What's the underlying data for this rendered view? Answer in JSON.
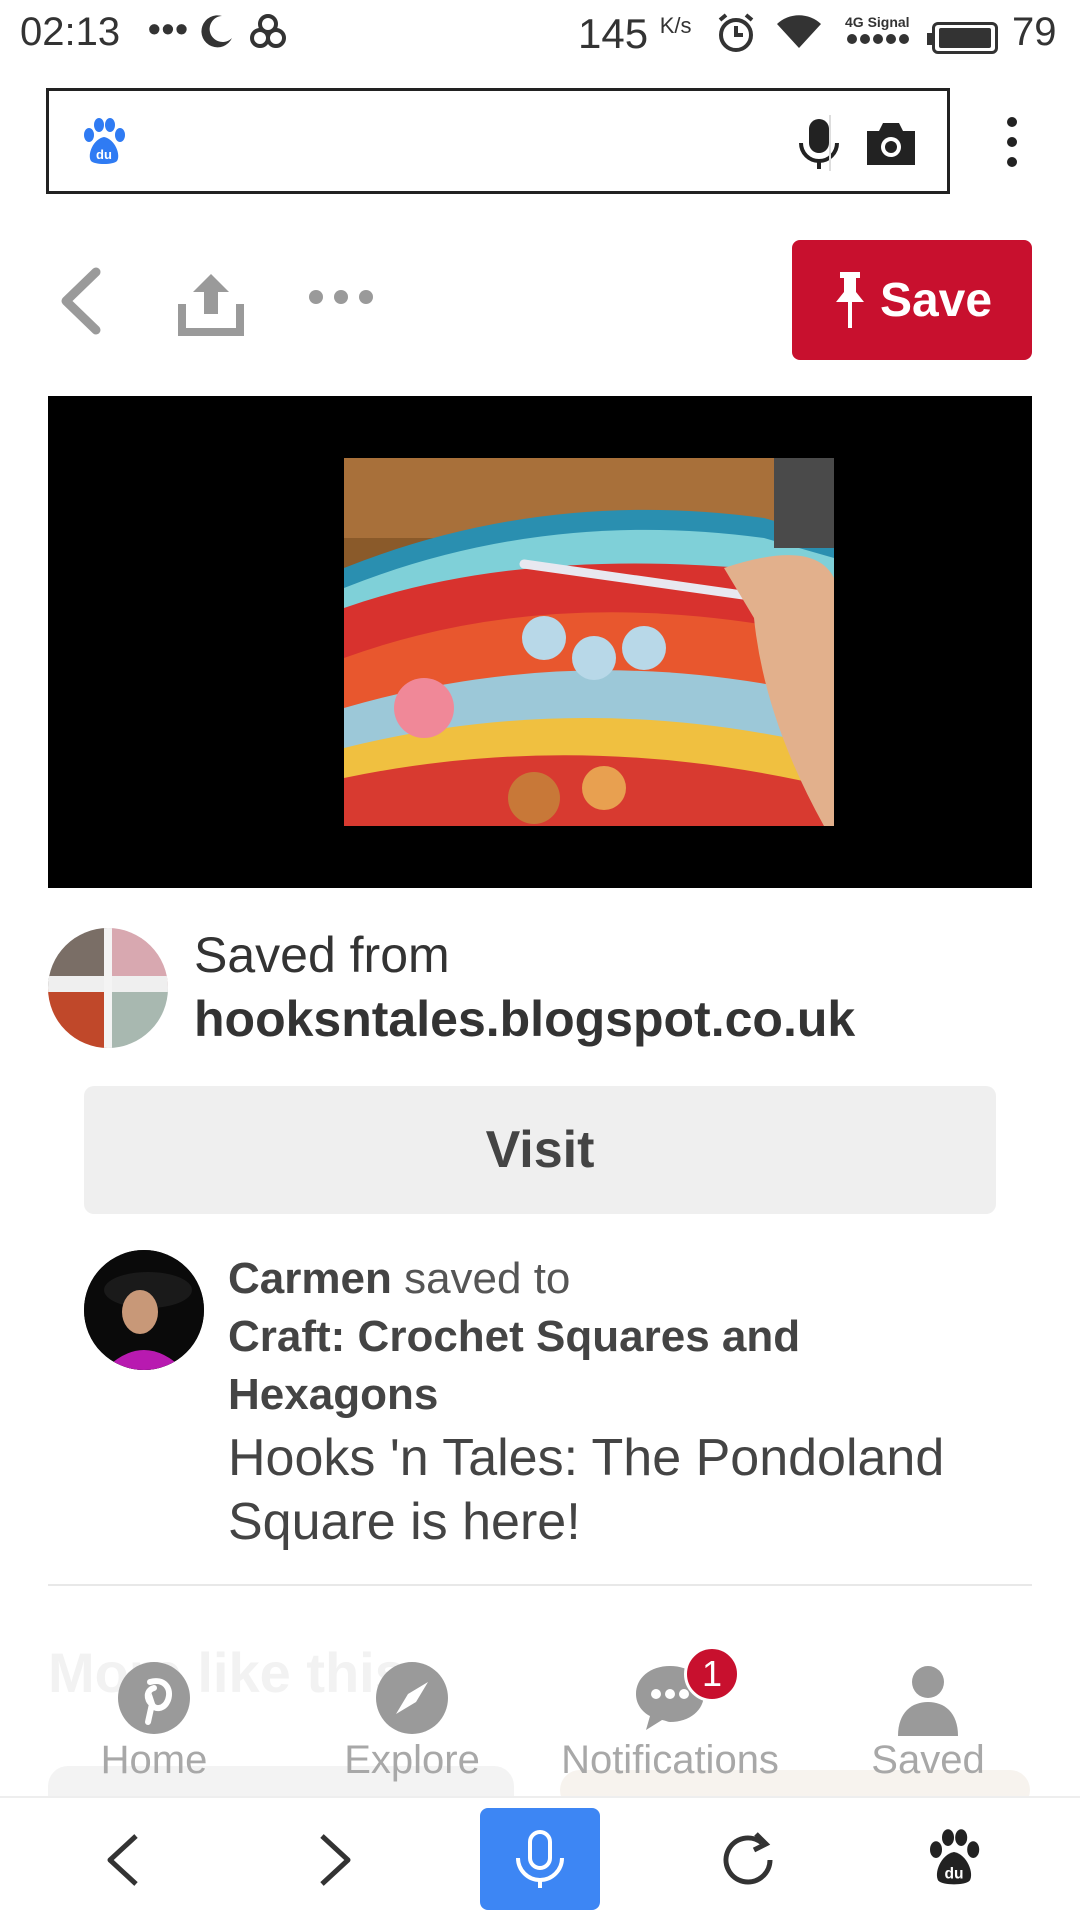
{
  "status_bar": {
    "time": "02:13",
    "more_dots": "•••",
    "net_speed": "145",
    "net_speed_unit": "K/s",
    "signal_label": "4G Signal",
    "battery": "79",
    "icons": [
      "moon-icon",
      "link-icon",
      "alarm-icon",
      "wifi-icon",
      "signal-icon",
      "battery-icon"
    ]
  },
  "browser": {
    "search_placeholder": "",
    "logo": "baidu-paw-icon",
    "accent": "#3d86f4"
  },
  "pin": {
    "save_label": "Save",
    "save_color": "#c8102e",
    "source_label": "Saved from",
    "source_domain": "hooksntales.blogspot.co.uk",
    "visit_label": "Visit",
    "saver_name": "Carmen",
    "saver_action": " saved to",
    "board_name": "Craft: Crochet Squares and Hexagons",
    "description": "Hooks 'n Tales: The Pondoland Square is here!",
    "more_like_this": "More like this"
  },
  "pin_nav": {
    "items": [
      {
        "label": "Home",
        "icon": "pinterest-icon"
      },
      {
        "label": "Explore",
        "icon": "compass-icon"
      },
      {
        "label": "Notifications",
        "icon": "chat-icon",
        "badge": "1"
      },
      {
        "label": "Saved",
        "icon": "person-icon"
      }
    ]
  }
}
